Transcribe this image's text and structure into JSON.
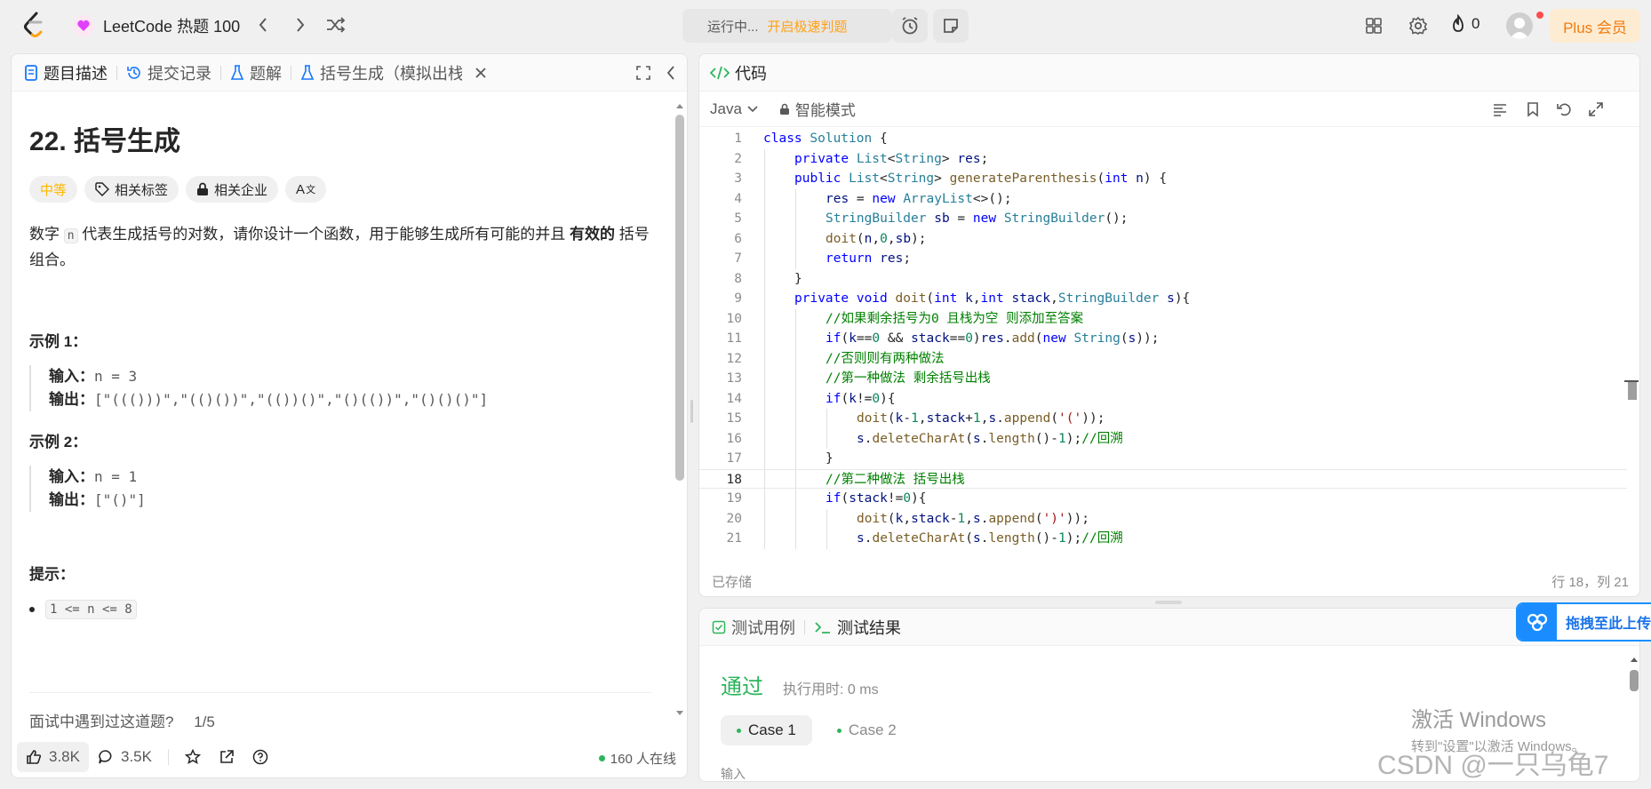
{
  "header": {
    "title": "LeetCode 热题 100",
    "run_status": "运行中...",
    "fast_judge": "开启极速判题",
    "fire_count": "0",
    "plus_label": "Plus 会员"
  },
  "left_panel": {
    "tabs": [
      {
        "label": "题目描述"
      },
      {
        "label": "提交记录"
      },
      {
        "label": "题解"
      },
      {
        "label": "括号生成（模拟出栈"
      }
    ],
    "problem_title": "22. 括号生成",
    "difficulty": "中等",
    "chip_tags": "相关标签",
    "chip_companies": "相关企业",
    "chip_translate": "A",
    "description": {
      "part1": "数字 ",
      "code": "n",
      "part2": " 代表生成括号的对数，请你设计一个函数，用于能够生成所有可能的并且 ",
      "bold": "有效的",
      "part3": " 括号组合。"
    },
    "example1": {
      "heading": "示例 1：",
      "input_label": "输入：",
      "input_value": "n = 3",
      "output_label": "输出：",
      "output_value": "[\"((()))\",\"(()())\",\"(())()\",\"()(())\",\"()()()\"]"
    },
    "example2": {
      "heading": "示例 2：",
      "input_label": "输入：",
      "input_value": "n = 1",
      "output_label": "输出：",
      "output_value": "[\"()\"]"
    },
    "hints_heading": "提示：",
    "hint_item": "1 <= n <= 8",
    "faq_text": "面试中遇到过这道题?",
    "faq_progress": "1/5",
    "likes": "3.8K",
    "comments": "3.5K",
    "online": "160 人在线"
  },
  "editor": {
    "tab_label": "代码",
    "language": "Java",
    "mode": "智能模式",
    "saved": "已存储",
    "cursor": "行 18，列 21"
  },
  "test_panel": {
    "tab_cases": "测试用例",
    "tab_result": "测试结果",
    "status": "通过",
    "runtime": "执行用时: 0 ms",
    "case1": "Case 1",
    "case2": "Case 2",
    "input_label": "输入"
  },
  "overlays": {
    "upload_label": "拖拽至此上传",
    "win_activate": "激活 Windows",
    "win_sub": "转到\"设置\"以激活 Windows。",
    "watermark": "CSDN @一只乌龟7"
  },
  "colors": {
    "accent_orange": "#ffa116",
    "pass_green": "#2db55d",
    "plus_bg": "#fdecd2",
    "keyword_blue": "#0000ff",
    "comment_green": "#008000"
  },
  "code_lines": [
    {
      "n": "1",
      "indent": 0,
      "tokens": [
        [
          "kw",
          "class "
        ],
        [
          "ty",
          "Solution"
        ],
        [
          "",
          " {"
        ]
      ]
    },
    {
      "n": "2",
      "indent": 1,
      "tokens": [
        [
          "kw",
          "private "
        ],
        [
          "ty",
          "List"
        ],
        [
          "",
          "<"
        ],
        [
          "ty",
          "String"
        ],
        [
          "",
          "> "
        ],
        [
          "var",
          "res"
        ],
        [
          "",
          ";"
        ]
      ]
    },
    {
      "n": "3",
      "indent": 1,
      "tokens": [
        [
          "kw",
          "public "
        ],
        [
          "ty",
          "List"
        ],
        [
          "",
          "<"
        ],
        [
          "ty",
          "String"
        ],
        [
          "",
          "> "
        ],
        [
          "fn",
          "generateParenthesis"
        ],
        [
          "",
          "("
        ],
        [
          "kw",
          "int "
        ],
        [
          "var",
          "n"
        ],
        [
          "",
          ") {"
        ]
      ]
    },
    {
      "n": "4",
      "indent": 2,
      "tokens": [
        [
          "var",
          "res"
        ],
        [
          "",
          " = "
        ],
        [
          "kw",
          "new "
        ],
        [
          "ty",
          "ArrayList"
        ],
        [
          "",
          "<>();"
        ]
      ]
    },
    {
      "n": "5",
      "indent": 2,
      "tokens": [
        [
          "ty",
          "StringBuilder "
        ],
        [
          "var",
          "sb"
        ],
        [
          "",
          " = "
        ],
        [
          "kw",
          "new "
        ],
        [
          "ty",
          "StringBuilder"
        ],
        [
          "",
          "();"
        ]
      ]
    },
    {
      "n": "6",
      "indent": 2,
      "tokens": [
        [
          "fn",
          "doit"
        ],
        [
          "",
          "("
        ],
        [
          "var",
          "n"
        ],
        [
          "",
          ","
        ],
        [
          "nu",
          "0"
        ],
        [
          "",
          ","
        ],
        [
          "var",
          "sb"
        ],
        [
          "",
          ");"
        ]
      ]
    },
    {
      "n": "7",
      "indent": 2,
      "tokens": [
        [
          "kw",
          "return "
        ],
        [
          "var",
          "res"
        ],
        [
          "",
          ";"
        ]
      ]
    },
    {
      "n": "8",
      "indent": 1,
      "tokens": [
        [
          "",
          "}"
        ]
      ]
    },
    {
      "n": "9",
      "indent": 1,
      "tokens": [
        [
          "kw",
          "private "
        ],
        [
          "kw",
          "void "
        ],
        [
          "fn",
          "doit"
        ],
        [
          "",
          "("
        ],
        [
          "kw",
          "int "
        ],
        [
          "var",
          "k"
        ],
        [
          "",
          ","
        ],
        [
          "kw",
          "int "
        ],
        [
          "var",
          "stack"
        ],
        [
          "",
          ","
        ],
        [
          "ty",
          "StringBuilder "
        ],
        [
          "var",
          "s"
        ],
        [
          "",
          "){"
        ]
      ]
    },
    {
      "n": "10",
      "indent": 2,
      "tokens": [
        [
          "cm",
          "//如果剩余括号为0 且栈为空 则添加至答案"
        ]
      ]
    },
    {
      "n": "11",
      "indent": 2,
      "tokens": [
        [
          "kw",
          "if"
        ],
        [
          "",
          "("
        ],
        [
          "var",
          "k"
        ],
        [
          "",
          "=="
        ],
        [
          "nu",
          "0"
        ],
        [
          "",
          " && "
        ],
        [
          "var",
          "stack"
        ],
        [
          "",
          "=="
        ],
        [
          "nu",
          "0"
        ],
        [
          "",
          ")"
        ],
        [
          "var",
          "res"
        ],
        [
          "",
          "."
        ],
        [
          "fn",
          "add"
        ],
        [
          "",
          "("
        ],
        [
          "kw",
          "new "
        ],
        [
          "ty",
          "String"
        ],
        [
          "",
          "("
        ],
        [
          "var",
          "s"
        ],
        [
          "",
          "));"
        ]
      ]
    },
    {
      "n": "12",
      "indent": 2,
      "tokens": [
        [
          "cm",
          "//否则则有两种做法"
        ]
      ]
    },
    {
      "n": "13",
      "indent": 2,
      "tokens": [
        [
          "cm",
          "//第一种做法 剩余括号出栈"
        ]
      ]
    },
    {
      "n": "14",
      "indent": 2,
      "tokens": [
        [
          "kw",
          "if"
        ],
        [
          "",
          "("
        ],
        [
          "var",
          "k"
        ],
        [
          "",
          "!="
        ],
        [
          "nu",
          "0"
        ],
        [
          "",
          "){"
        ]
      ]
    },
    {
      "n": "15",
      "indent": 3,
      "tokens": [
        [
          "fn",
          "doit"
        ],
        [
          "",
          "("
        ],
        [
          "var",
          "k"
        ],
        [
          "",
          "-"
        ],
        [
          "nu",
          "1"
        ],
        [
          "",
          ","
        ],
        [
          "var",
          "stack"
        ],
        [
          "",
          "+"
        ],
        [
          "nu",
          "1"
        ],
        [
          "",
          ","
        ],
        [
          "var",
          "s"
        ],
        [
          "",
          "."
        ],
        [
          "fn",
          "append"
        ],
        [
          "",
          "("
        ],
        [
          "st",
          "'('"
        ],
        [
          "",
          "));"
        ]
      ]
    },
    {
      "n": "16",
      "indent": 3,
      "tokens": [
        [
          "var",
          "s"
        ],
        [
          "",
          "."
        ],
        [
          "fn",
          "deleteCharAt"
        ],
        [
          "",
          "("
        ],
        [
          "var",
          "s"
        ],
        [
          "",
          "."
        ],
        [
          "fn",
          "length"
        ],
        [
          "",
          "()-"
        ],
        [
          "nu",
          "1"
        ],
        [
          "",
          ");"
        ],
        [
          "cm",
          "//回溯"
        ]
      ]
    },
    {
      "n": "17",
      "indent": 2,
      "tokens": [
        [
          "",
          "}"
        ]
      ]
    },
    {
      "n": "18",
      "indent": 2,
      "tokens": [
        [
          "cm",
          "//第二种做法 括号出栈"
        ]
      ]
    },
    {
      "n": "19",
      "indent": 2,
      "tokens": [
        [
          "kw",
          "if"
        ],
        [
          "",
          "("
        ],
        [
          "var",
          "stack"
        ],
        [
          "",
          "!="
        ],
        [
          "nu",
          "0"
        ],
        [
          "",
          "){"
        ]
      ]
    },
    {
      "n": "20",
      "indent": 3,
      "tokens": [
        [
          "fn",
          "doit"
        ],
        [
          "",
          "("
        ],
        [
          "var",
          "k"
        ],
        [
          "",
          ","
        ],
        [
          "var",
          "stack"
        ],
        [
          "",
          "-"
        ],
        [
          "nu",
          "1"
        ],
        [
          "",
          ","
        ],
        [
          "var",
          "s"
        ],
        [
          "",
          "."
        ],
        [
          "fn",
          "append"
        ],
        [
          "",
          "("
        ],
        [
          "st",
          "')'"
        ],
        [
          "",
          "));"
        ]
      ]
    },
    {
      "n": "21",
      "indent": 3,
      "tokens": [
        [
          "var",
          "s"
        ],
        [
          "",
          "."
        ],
        [
          "fn",
          "deleteCharAt"
        ],
        [
          "",
          "("
        ],
        [
          "var",
          "s"
        ],
        [
          "",
          "."
        ],
        [
          "fn",
          "length"
        ],
        [
          "",
          "()-"
        ],
        [
          "nu",
          "1"
        ],
        [
          "",
          ");"
        ],
        [
          "cm",
          "//回溯"
        ]
      ]
    }
  ]
}
